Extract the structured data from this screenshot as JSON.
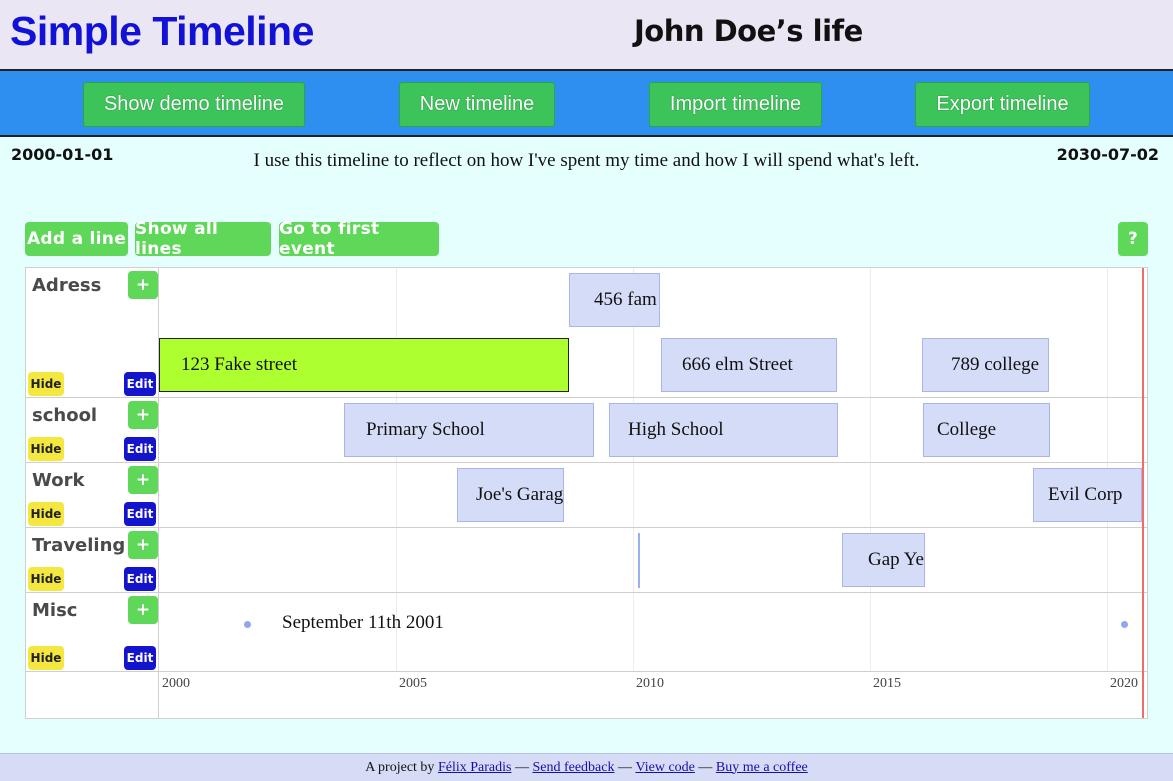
{
  "header": {
    "app_title": "Simple Timeline",
    "timeline_title": "John Doe’s life"
  },
  "toolbar": {
    "show_demo": "Show demo timeline",
    "new_timeline": "New timeline",
    "import_timeline": "Import timeline",
    "export_timeline": "Export timeline"
  },
  "timeline_meta": {
    "start_date": "2000-01-01",
    "end_date": "2030-07-02",
    "description": "I use this timeline to reflect on how I've spent my time and how I will spend what's left."
  },
  "controls": {
    "add_line": "Add a line",
    "show_all_lines": "Show all lines",
    "go_first_event": "Go to first event",
    "help": "?"
  },
  "lane_buttons": {
    "add": "+",
    "hide": "Hide",
    "edit": "Edit"
  },
  "lanes": [
    {
      "name": "Adress"
    },
    {
      "name": "school"
    },
    {
      "name": "Work"
    },
    {
      "name": "Traveling"
    },
    {
      "name": "Misc"
    }
  ],
  "items": {
    "fam_456": "456 fam",
    "fake_street_123": "123 Fake street",
    "elm_666": "666 elm Street",
    "college_789": "789 college",
    "primary": "Primary School",
    "high": "High School",
    "college": "College",
    "joes": "Joe's Garag",
    "evil": "Evil Corp",
    "gap": "Gap Ye",
    "sept11": "September 11th 2001"
  },
  "axis": [
    "2000",
    "2005",
    "2010",
    "2015",
    "2020"
  ],
  "footer": {
    "prefix": "A project by ",
    "author": "Félix Paradis",
    "send_feedback": "Send feedback",
    "view_code": "View code",
    "coffee": "Buy me a coffee",
    "sep": " — "
  },
  "colors": {
    "app_title": "#1212d6",
    "toolbar_bg": "#2f8ff0",
    "green_button": "#3cc35a",
    "selected_item": "#adff2f",
    "item_bg": "#d5dcf7",
    "current_time": "#f06b6b",
    "hide_button": "#f4e840",
    "edit_button": "#1414cc"
  }
}
